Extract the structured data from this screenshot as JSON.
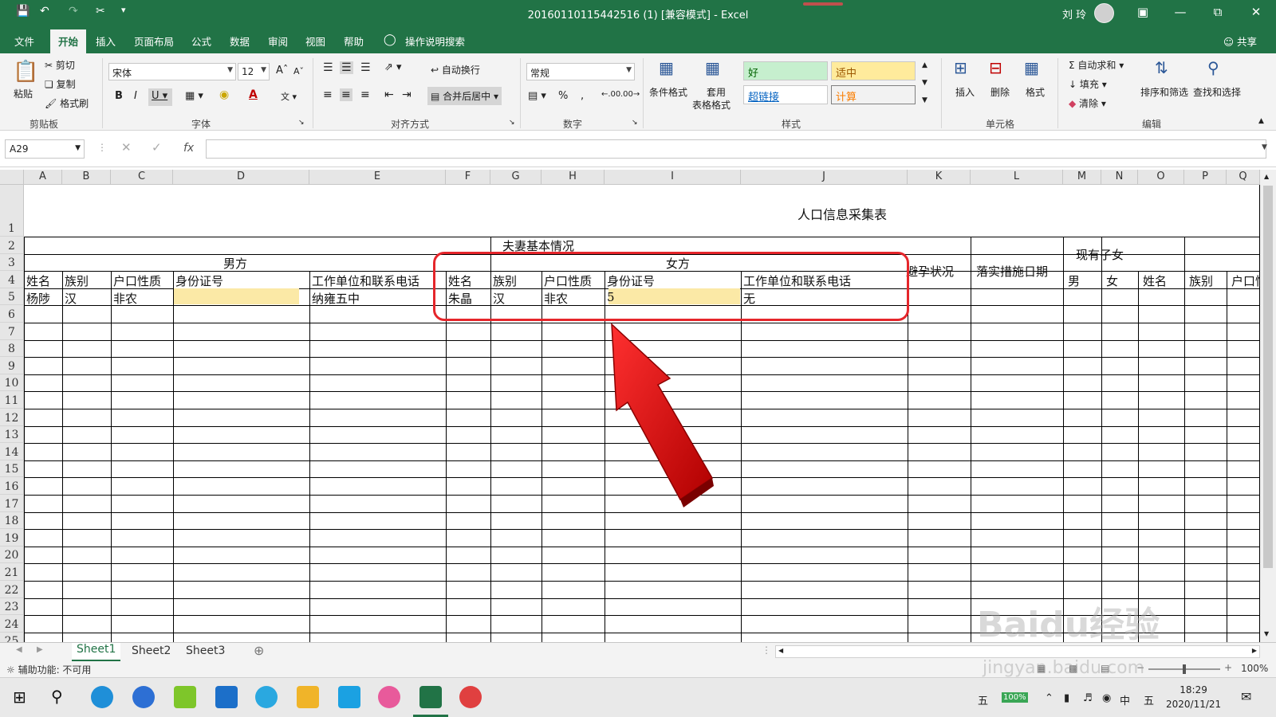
{
  "window": {
    "title": "20160110115442516 (1) [兼容模式] - Excel",
    "user": "刘 玲"
  },
  "menu": {
    "tabs": [
      "文件",
      "开始",
      "插入",
      "页面布局",
      "公式",
      "数据",
      "审阅",
      "视图",
      "帮助"
    ],
    "search": "操作说明搜索",
    "share": "共享"
  },
  "ribbon": {
    "clipboard": {
      "label": "剪贴板",
      "paste": "粘贴",
      "cut": "剪切",
      "copy": "复制",
      "format_painter": "格式刷"
    },
    "font": {
      "label": "字体",
      "name": "宋体",
      "size": "12"
    },
    "alignment": {
      "label": "对齐方式",
      "wrap": "自动换行",
      "merge": "合并后居中"
    },
    "number": {
      "label": "数字",
      "format": "常规"
    },
    "styles": {
      "label": "样式",
      "conditional": "条件格式",
      "table_1": "套用",
      "table_2": "表格格式",
      "good": "好",
      "neutral": "适中",
      "hyperlink": "超链接",
      "calc": "计算"
    },
    "cells": {
      "label": "单元格",
      "insert": "插入",
      "delete": "删除",
      "format": "格式"
    },
    "editing": {
      "label": "编辑",
      "autosum": "自动求和",
      "fill": "填充",
      "clear": "清除",
      "sort": "排序和筛选",
      "find": "查找和选择"
    }
  },
  "formula_bar": {
    "name_box": "A29",
    "fx": "fx"
  },
  "columns": [
    "A",
    "B",
    "C",
    "D",
    "E",
    "F",
    "G",
    "H",
    "I",
    "J",
    "K",
    "L",
    "M",
    "N",
    "O",
    "P",
    "Q"
  ],
  "rows": [
    "1",
    "2",
    "3",
    "4",
    "5",
    "6",
    "7",
    "8",
    "9",
    "10",
    "11",
    "12",
    "13",
    "14",
    "15",
    "16",
    "17",
    "18",
    "19",
    "20",
    "21",
    "22",
    "23",
    "24",
    "25"
  ],
  "sheet": {
    "title": "人口信息采集表",
    "couple_header": "夫妻基本情况",
    "male": "男方",
    "female": "女方",
    "contraception": "避孕状况",
    "measure_date": "落实措施日期",
    "children": "现有子女",
    "headers": [
      "姓名",
      "族别",
      "户口性质",
      "身份证号",
      "工作单位和联系电话",
      "姓名",
      "族别",
      "户口性质",
      "身份证号",
      "工作单位和联系电话"
    ],
    "child_headers": [
      "男",
      "女",
      "姓名",
      "族别",
      "户口性"
    ],
    "row5": [
      "杨陟",
      "汉",
      "非农",
      "",
      "纳雍五中",
      "朱晶",
      "汉",
      "非农",
      "5",
      "无"
    ]
  },
  "sheet_tabs": [
    "Sheet1",
    "Sheet2",
    "Sheet3"
  ],
  "status": {
    "accessibility": "辅助功能: 不可用",
    "zoom": "100%"
  },
  "taskbar": {
    "time": "18:29",
    "date": "2020/11/21",
    "ime": "中",
    "ime2": "五",
    "battery": "100%"
  },
  "watermark": {
    "brand": "Baidu经验",
    "url": "jingyan.baidu.com"
  },
  "colors": {
    "excel_green": "#217346",
    "highlight": "#fbe9a6",
    "annotation_red": "#e5262b"
  }
}
